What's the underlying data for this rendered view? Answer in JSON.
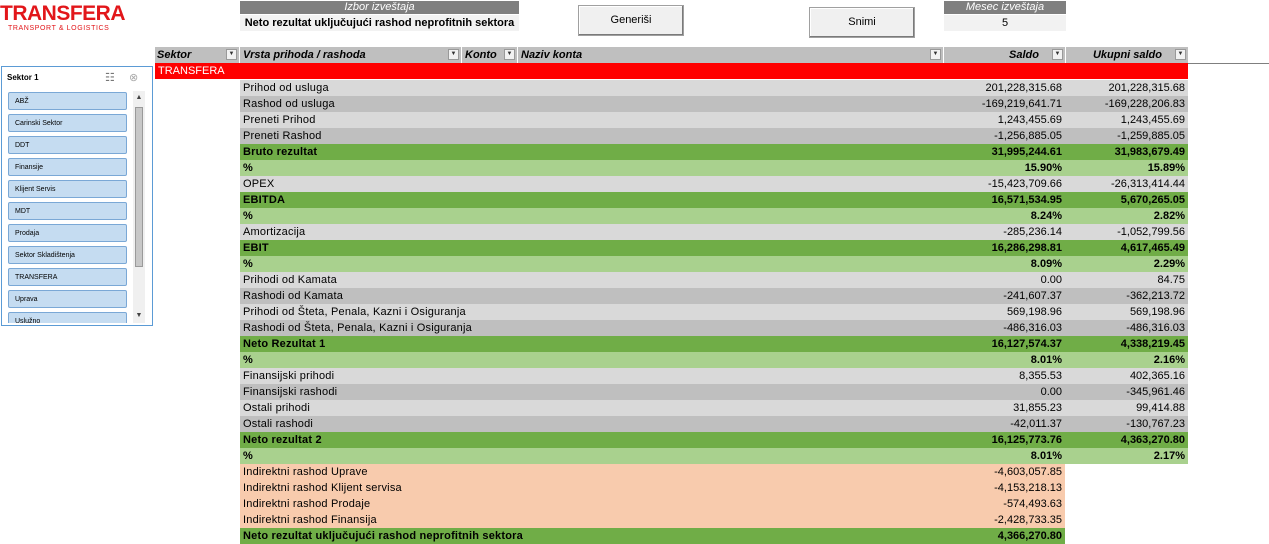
{
  "logo": {
    "main": "TRANSFERA",
    "sub": "TRANSPORT & LOGISTICS"
  },
  "report_select": {
    "title": "Izbor izveštaja",
    "value": "Neto rezultat uključujući rashod neprofitnih sektora"
  },
  "buttons": {
    "generate": "Generiši",
    "save": "Snimi"
  },
  "month": {
    "title": "Mesec izveštaja",
    "value": "5"
  },
  "slicer": {
    "title": "Sektor 1",
    "items": [
      "ABŽ",
      "Carinski Sektor",
      "DDT",
      "Finansije",
      "Klijent Servis",
      "MDT",
      "Prodaja",
      "Sektor Skladištenja",
      "TRANSFERA",
      "Uprava",
      "Uslužno"
    ]
  },
  "table": {
    "headers": {
      "sektor": "Sektor",
      "vrsta": "Vrsta prihoda / rashoda",
      "konto": "Konto",
      "naziv": "Naziv konta",
      "saldo": "Saldo",
      "ukupni": "Ukupni saldo"
    },
    "group": "TRANSFERA",
    "rows": [
      {
        "label": "Prihod od usluga",
        "saldo": "201,228,315.68",
        "ukupni": "201,228,315.68",
        "style": "t-lg"
      },
      {
        "label": "Rashod od usluga",
        "saldo": "-169,219,641.71",
        "ukupni": "-169,228,206.83",
        "style": "t-dg"
      },
      {
        "label": "Preneti Prihod",
        "saldo": "1,243,455.69",
        "ukupni": "1,243,455.69",
        "style": "t-lg"
      },
      {
        "label": "Preneti Rashod",
        "saldo": "-1,256,885.05",
        "ukupni": "-1,259,885.05",
        "style": "t-dg"
      },
      {
        "label": "Bruto rezultat",
        "saldo": "31,995,244.61",
        "ukupni": "31,983,679.49",
        "style": "t-gb"
      },
      {
        "label": "%",
        "saldo": "15.90%",
        "ukupni": "15.89%",
        "style": "t-gl"
      },
      {
        "label": "OPEX",
        "saldo": "-15,423,709.66",
        "ukupni": "-26,313,414.44",
        "style": "t-lg"
      },
      {
        "label": "EBITDA",
        "saldo": "16,571,534.95",
        "ukupni": "5,670,265.05",
        "style": "t-gb"
      },
      {
        "label": "%",
        "saldo": "8.24%",
        "ukupni": "2.82%",
        "style": "t-gl"
      },
      {
        "label": "Amortizacija",
        "saldo": "-285,236.14",
        "ukupni": "-1,052,799.56",
        "style": "t-lg"
      },
      {
        "label": "EBIT",
        "saldo": "16,286,298.81",
        "ukupni": "4,617,465.49",
        "style": "t-gb"
      },
      {
        "label": "%",
        "saldo": "8.09%",
        "ukupni": "2.29%",
        "style": "t-gl"
      },
      {
        "label": "Prihodi od Kamata",
        "saldo": "0.00",
        "ukupni": "84.75",
        "style": "t-lg"
      },
      {
        "label": "Rashodi od Kamata",
        "saldo": "-241,607.37",
        "ukupni": "-362,213.72",
        "style": "t-dg"
      },
      {
        "label": "Prihodi od Šteta, Penala, Kazni i Osiguranja",
        "saldo": "569,198.96",
        "ukupni": "569,198.96",
        "style": "t-lg"
      },
      {
        "label": "Rashodi od Šteta, Penala, Kazni i Osiguranja",
        "saldo": "-486,316.03",
        "ukupni": "-486,316.03",
        "style": "t-dg"
      },
      {
        "label": "Neto Rezultat 1",
        "saldo": "16,127,574.37",
        "ukupni": "4,338,219.45",
        "style": "t-gb"
      },
      {
        "label": "%",
        "saldo": "8.01%",
        "ukupni": "2.16%",
        "style": "t-gl"
      },
      {
        "label": "Finansijski prihodi",
        "saldo": "8,355.53",
        "ukupni": "402,365.16",
        "style": "t-lg"
      },
      {
        "label": "Finansijski rashodi",
        "saldo": "0.00",
        "ukupni": "-345,961.46",
        "style": "t-dg"
      },
      {
        "label": "Ostali prihodi",
        "saldo": "31,855.23",
        "ukupni": "99,414.88",
        "style": "t-lg"
      },
      {
        "label": "Ostali rashodi",
        "saldo": "-42,011.37",
        "ukupni": "-130,767.23",
        "style": "t-dg"
      },
      {
        "label": "Neto rezultat 2",
        "saldo": "16,125,773.76",
        "ukupni": "4,363,270.80",
        "style": "t-gb"
      },
      {
        "label": "%",
        "saldo": "8.01%",
        "ukupni": "2.17%",
        "style": "t-gl"
      }
    ],
    "indirect_rows": [
      {
        "label": "Indirektni rashod Uprave",
        "saldo": "-4,603,057.85"
      },
      {
        "label": "Indirektni rashod Klijent servisa",
        "saldo": "-4,153,218.13"
      },
      {
        "label": "Indirektni rashod Prodaje",
        "saldo": "-574,493.63"
      },
      {
        "label": "Indirektni rashod Finansija",
        "saldo": "-2,428,733.35"
      }
    ],
    "final_row": {
      "label": "Neto rezultat uključujući rashod neprofitnih sektora",
      "saldo": "4,366,270.80"
    }
  },
  "colors": {
    "brand_red": "#e2161a",
    "green_dark": "#70ad47",
    "green_light": "#a9d18e",
    "orange_light": "#f8cbad"
  }
}
